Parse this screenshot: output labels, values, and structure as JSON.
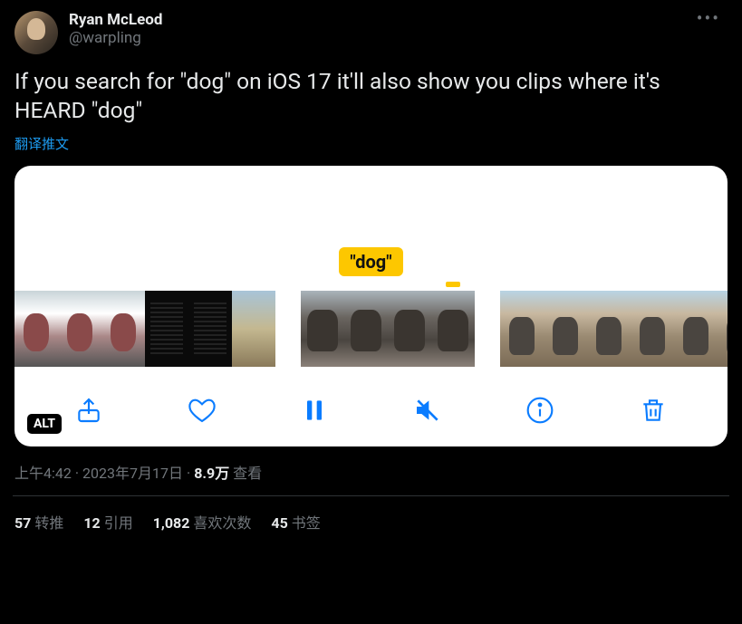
{
  "user": {
    "display_name": "Ryan McLeod",
    "handle": "@warpling"
  },
  "tweet_text": "If you search for \"dog\" on iOS 17 it'll also show you clips where it's HEARD \"dog\"",
  "translate_label": "翻译推文",
  "media": {
    "search_tag": "\"dog\"",
    "alt_badge": "ALT"
  },
  "meta": {
    "time": "上午4:42",
    "date": "2023年7月17日",
    "views_number": "8.9万",
    "views_label": "查看"
  },
  "stats": {
    "retweets_num": "57",
    "retweets_label": "转推",
    "quotes_num": "12",
    "quotes_label": "引用",
    "likes_num": "1,082",
    "likes_label": "喜欢次数",
    "bookmarks_num": "45",
    "bookmarks_label": "书签"
  },
  "icons": {
    "share": "share-icon",
    "heart": "heart-icon",
    "pause": "pause-icon",
    "mute": "speaker-muted-icon",
    "info": "info-icon",
    "trash": "trash-icon",
    "more": "more-icon"
  }
}
